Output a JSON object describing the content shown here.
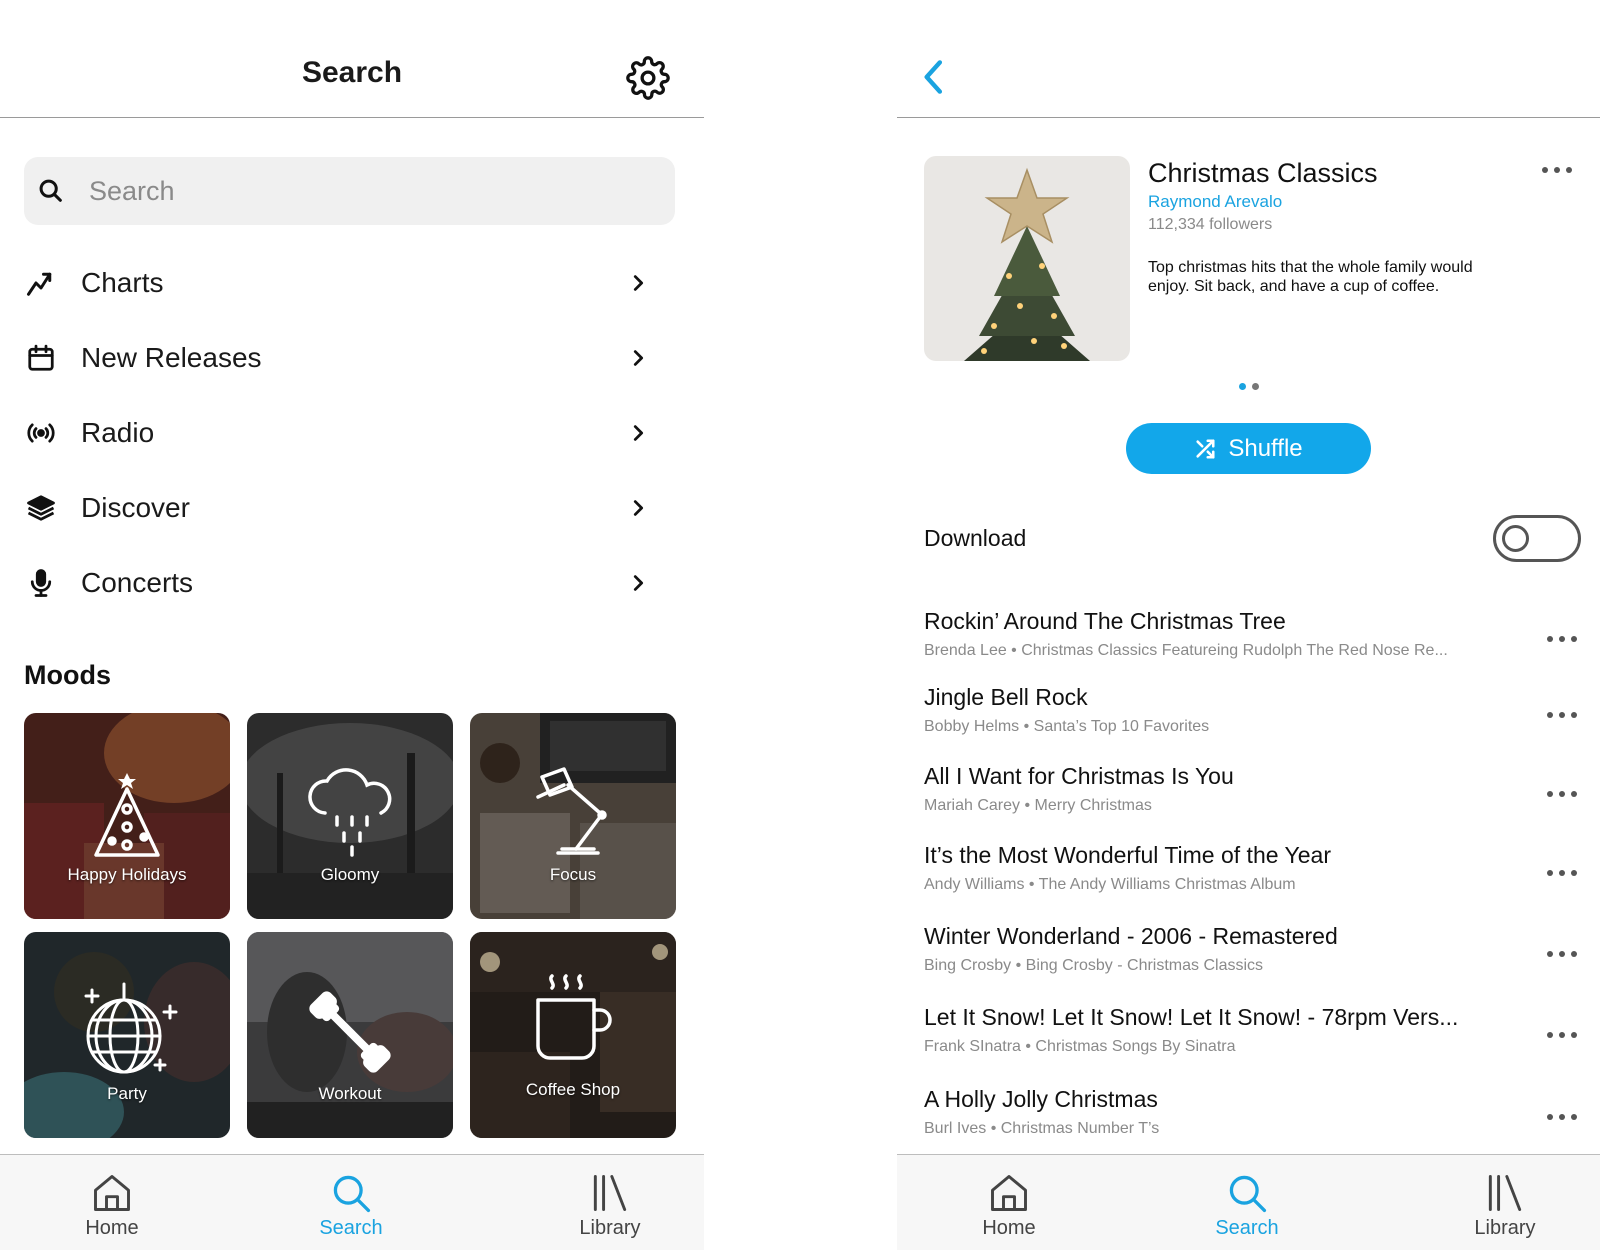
{
  "colors": {
    "accent": "#1aa3e0",
    "shuffle_bg": "#12a7ea",
    "muted": "#8a8a8a"
  },
  "left": {
    "header": {
      "title": "Search",
      "settings_icon": "gear-icon"
    },
    "search": {
      "placeholder": "Search",
      "icon": "search-icon"
    },
    "nav": [
      {
        "label": "Charts",
        "icon": "trending-up-icon"
      },
      {
        "label": "New Releases",
        "icon": "calendar-icon"
      },
      {
        "label": "Radio",
        "icon": "broadcast-icon"
      },
      {
        "label": "Discover",
        "icon": "layers-icon"
      },
      {
        "label": "Concerts",
        "icon": "microphone-icon"
      }
    ],
    "moods": {
      "title": "Moods",
      "tiles": [
        {
          "label": "Happy Holidays",
          "icon": "christmas-tree-icon"
        },
        {
          "label": "Gloomy",
          "icon": "rain-cloud-icon"
        },
        {
          "label": "Focus",
          "icon": "desk-lamp-icon"
        },
        {
          "label": "Party",
          "icon": "disco-ball-icon"
        },
        {
          "label": "Workout",
          "icon": "dumbbell-icon"
        },
        {
          "label": "Coffee Shop",
          "icon": "coffee-cup-icon"
        }
      ]
    }
  },
  "right": {
    "header": {
      "back_icon": "chevron-left-icon"
    },
    "playlist": {
      "title": "Christmas Classics",
      "owner": "Raymond Arevalo",
      "followers": "112,334 followers",
      "description": "Top christmas hits that the whole family would enjoy. Sit back, and have a cup of coffee.",
      "cover_icon": "christmas-tree-star-image"
    },
    "pager": {
      "pages": 2,
      "active": 1
    },
    "shuffle_label": "Shuffle",
    "download": {
      "label": "Download",
      "enabled": false
    },
    "tracks": [
      {
        "title": "Rockin’ Around The Christmas Tree",
        "subtitle": "Brenda Lee • Christmas Classics Featureing Rudolph The Red Nose Re..."
      },
      {
        "title": "Jingle Bell Rock",
        "subtitle": "Bobby Helms • Santa’s Top 10 Favorites"
      },
      {
        "title": "All I Want for Christmas Is You",
        "subtitle": "Mariah Carey • Merry Christmas"
      },
      {
        "title": "It’s the Most Wonderful Time of the Year",
        "subtitle": "Andy Williams • The Andy Williams Christmas Album"
      },
      {
        "title": "Winter Wonderland - 2006 - Remastered",
        "subtitle": "Bing Crosby • Bing Crosby - Christmas Classics"
      },
      {
        "title": "Let It Snow! Let It Snow! Let It Snow! - 78rpm Vers...",
        "subtitle": "Frank SInatra • Christmas Songs By Sinatra"
      },
      {
        "title": "A Holly Jolly Christmas",
        "subtitle": "Burl Ives • Christmas Number T’s"
      }
    ]
  },
  "tabbar": {
    "tabs": [
      {
        "label": "Home",
        "icon": "home-icon"
      },
      {
        "label": "Search",
        "icon": "search-icon"
      },
      {
        "label": "Library",
        "icon": "library-icon"
      }
    ],
    "active": "Search"
  }
}
